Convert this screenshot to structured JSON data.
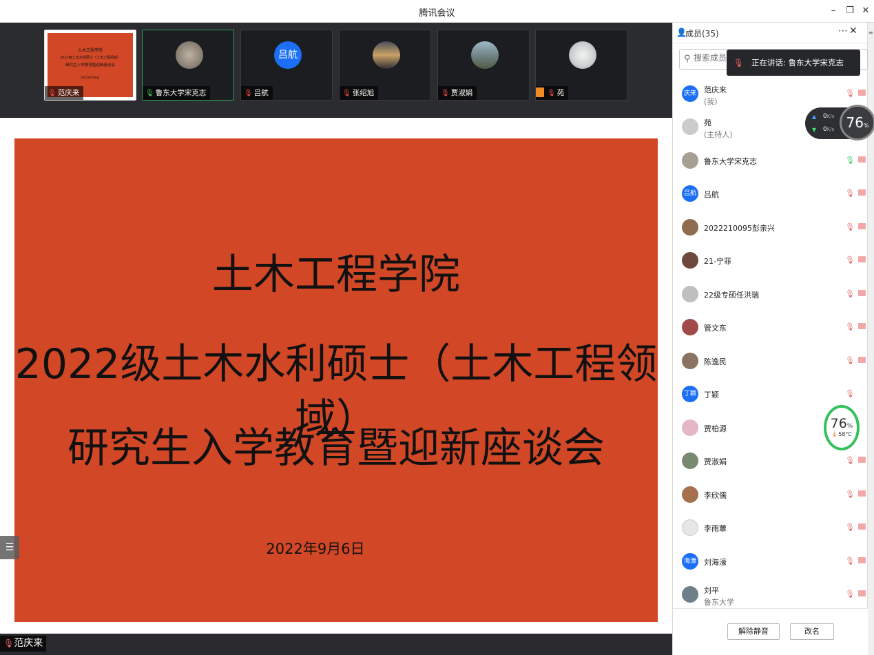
{
  "window": {
    "title": "腾讯会议",
    "minimize": "–",
    "restore": "❐",
    "close": "✕"
  },
  "video_strip": {
    "tiles": [
      {
        "name": "范庆来",
        "mic": "muted",
        "slide": {
          "line1": "土木工程学院",
          "line2": "2022级土木水利硕士（土木工程领域）",
          "line3": "研究生入学教育暨迎新座谈会",
          "date": "2022年9月6日"
        }
      },
      {
        "name": "鲁东大学宋克志",
        "mic": "active"
      },
      {
        "name": "吕航",
        "mic": "muted",
        "avatar_text": "吕航"
      },
      {
        "name": "张绍旭",
        "mic": "muted"
      },
      {
        "name": "贾淑娟",
        "mic": "muted"
      },
      {
        "name": "苑",
        "mic": "muted"
      }
    ]
  },
  "slide": {
    "line1": "土木工程学院",
    "line2": "2022级土木水利硕士（土木工程领域）",
    "line3": "研究生入学教育暨迎新座谈会",
    "date": "2022年9月6日",
    "background": "#d24726"
  },
  "active_speaker_label": "范庆来",
  "members_panel": {
    "title": "成员(35)",
    "search_placeholder": "搜索成员",
    "speaking_toast": "正在讲话: 鲁东大学宋克志",
    "network": {
      "up": "0",
      "down": "0",
      "unit": "K/s",
      "percent": "76",
      "pct_sign": "%"
    },
    "cpu_gauge": {
      "percent": "76",
      "pct_sign": "%",
      "temp": "58°C"
    },
    "members": [
      {
        "name": "范庆来",
        "sub": "(我)",
        "avatar_text": "庆来",
        "avatar_color": "#1a6ff5"
      },
      {
        "name": "苑",
        "sub": "(主持人)",
        "avatar_color": "#c9cbcc"
      },
      {
        "name": "鲁东大学宋克志",
        "mic": "active",
        "avatar_color": "#a89f94"
      },
      {
        "name": "吕航",
        "avatar_text": "吕航",
        "avatar_color": "#1a6ff5"
      },
      {
        "name": "2022210095彭亲兴",
        "avatar_color": "#8f6c4f"
      },
      {
        "name": "21-宁菲",
        "avatar_color": "#6f4a3c"
      },
      {
        "name": "22级专硕任洪瑞",
        "avatar_color": "#bfbfbf"
      },
      {
        "name": "管文东",
        "avatar_color": "#a04a4a"
      },
      {
        "name": "陈逸民",
        "avatar_color": "#8b7262"
      },
      {
        "name": "丁颖",
        "avatar_text": "丁颖",
        "avatar_color": "#1a6ff5"
      },
      {
        "name": "贾柏源",
        "avatar_color": "#e5b7c6"
      },
      {
        "name": "贾淑娟",
        "avatar_color": "#7a8a70"
      },
      {
        "name": "李欣儒",
        "avatar_color": "#a5704e"
      },
      {
        "name": "李雨蕈",
        "avatar_color": "#e6e6e6"
      },
      {
        "name": "刘海濠",
        "avatar_text": "海濠",
        "avatar_color": "#1a6ff5"
      },
      {
        "name": "刘平",
        "sub": "鲁东大学",
        "avatar_color": "#6f7f88"
      }
    ],
    "footer": {
      "unmute_all": "解除静音",
      "rename": "改名"
    }
  }
}
